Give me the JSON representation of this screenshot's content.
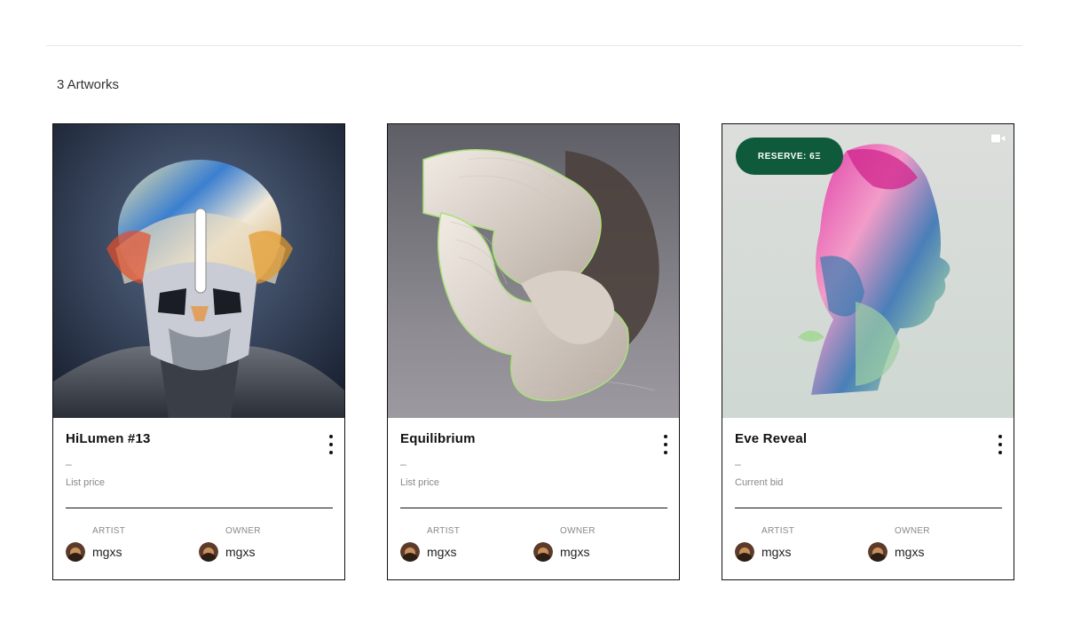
{
  "artworks_count": "3 Artworks",
  "cards": [
    {
      "title": "HiLumen #13",
      "price": "–",
      "price_label": "List price",
      "artist_label": "ARTIST",
      "artist": "mgxs",
      "owner_label": "OWNER",
      "owner": "mgxs"
    },
    {
      "title": "Equilibrium",
      "price": "–",
      "price_label": "List price",
      "artist_label": "ARTIST",
      "artist": "mgxs",
      "owner_label": "OWNER",
      "owner": "mgxs"
    },
    {
      "title": "Eve Reveal",
      "price": "–",
      "price_label": "Current bid",
      "artist_label": "ARTIST",
      "artist": "mgxs",
      "owner_label": "OWNER",
      "owner": "mgxs",
      "badge": "RESERVE: 6Ξ",
      "media_icon": "video-icon"
    }
  ],
  "colors": {
    "badge_bg": "#0e5a3a",
    "border": "#111111"
  }
}
